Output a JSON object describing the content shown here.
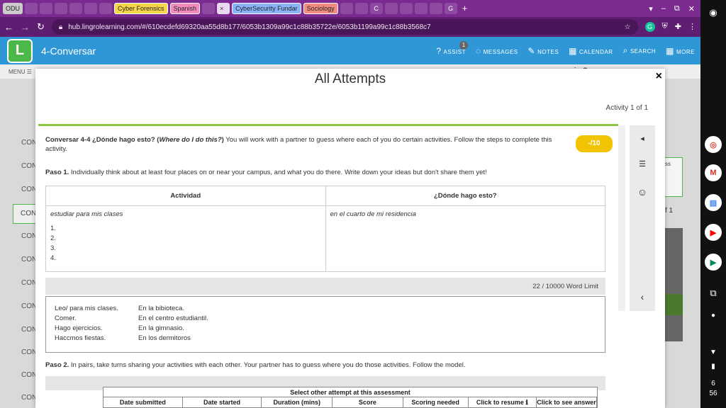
{
  "browser": {
    "tabs": [
      {
        "label": "ODU",
        "kind": "text"
      },
      {
        "label": "",
        "kind": "icon"
      },
      {
        "label": "",
        "kind": "icon"
      },
      {
        "label": "",
        "kind": "icon"
      },
      {
        "label": "",
        "kind": "icon"
      },
      {
        "label": "",
        "kind": "icon"
      },
      {
        "label": "",
        "kind": "icon"
      },
      {
        "label": "Cyber Forensics",
        "kind": "group",
        "color": "#f7d64a"
      },
      {
        "label": "Spanish",
        "kind": "group",
        "color": "#f28cc0"
      },
      {
        "label": "",
        "kind": "icon"
      },
      {
        "label": "×",
        "kind": "active"
      },
      {
        "label": "CyberSecurity Fundar",
        "kind": "group",
        "color": "#8ab4f8"
      },
      {
        "label": "Sociology",
        "kind": "group",
        "color": "#f28b82"
      },
      {
        "label": "",
        "kind": "icon"
      },
      {
        "label": "",
        "kind": "icon"
      },
      {
        "label": "C",
        "kind": "icon"
      },
      {
        "label": "",
        "kind": "icon"
      },
      {
        "label": "",
        "kind": "icon"
      },
      {
        "label": "",
        "kind": "icon"
      },
      {
        "label": "",
        "kind": "icon"
      },
      {
        "label": "G",
        "kind": "icon"
      }
    ],
    "new_tab": "+",
    "url": "hub.lingrolearning.com/#/610ecdefd69320aa55d8b177/6053b1309a99c1c88b35722e/6053b1199a99c1c88b3568c7"
  },
  "app": {
    "title": "4-Conversar",
    "logo_letter": "L",
    "nav": [
      {
        "icon": "?",
        "label": "ASSIST"
      },
      {
        "icon": "◌",
        "label": "MESSAGES"
      },
      {
        "icon": "✎",
        "label": "NOTES"
      },
      {
        "icon": "▦",
        "label": "CALENDAR"
      },
      {
        "icon": "⌕",
        "label": "SEARCH"
      },
      {
        "icon": "▦",
        "label": "MORE"
      }
    ],
    "messages_count": "1"
  },
  "background": {
    "menu": "MENU ☰",
    "rows": [
      "CON",
      "CON",
      "CON",
      "CON",
      "CON",
      "CON",
      "CON",
      "CON",
      "CON",
      "CON",
      "CON",
      "CON"
    ],
    "active_row": "CON",
    "top_right_text": "iro?",
    "right_box_text": "ss",
    "right_count": "f 1"
  },
  "modal": {
    "title": "All Attempts",
    "close": "×",
    "activity_count": "Activity 1 of 1",
    "intro_bold": "Conversar 4-4 ¿Dónde hago esto? (",
    "intro_italic": "Where do I do this?",
    "intro_bold_end": ")",
    "intro_rest": " You will work with a partner to guess where each of you do certain activities. Follow the steps to complete this activity.",
    "score": "-/10",
    "paso1_label": "Paso 1.",
    "paso1_text": " Individually think about at least four places on or near your campus, and what you do there. Write down your ideas but don't share them yet!",
    "table": {
      "headers": [
        "Actividad",
        "¿Dónde hago esto?"
      ],
      "col1_example": "estudiar para mis clases",
      "col2_example": "en el cuarto de mi residencia",
      "numbers": [
        "1.",
        "2.",
        "3.",
        "4."
      ]
    },
    "word_limit": "22 /  10000 Word Limit",
    "answer_lines": [
      [
        "Leo/ para mis clases.",
        "En la bibioteca."
      ],
      [
        "Comer.",
        "En el centro estudiantil."
      ],
      [
        "Hago ejercicios.",
        "En la gimnasio."
      ],
      [
        "Haccmos fiestas.",
        "En los dermitoros"
      ]
    ],
    "paso2_label": "Paso 2.",
    "paso2_text": " In pairs, take turns sharing your activities with each other. Your partner has to guess where you do those activities. Follow the model.",
    "side_icons": [
      "◂",
      "☰",
      "☺",
      "‹"
    ]
  },
  "attempts": {
    "caption": "Select other attempt at this assessment",
    "columns": [
      "Date submitted",
      "Date started",
      "Duration (mins)",
      "Score",
      "Scoring needed",
      "Click to  resume ℹ",
      "Click to see answers"
    ]
  },
  "shelf": {
    "time_hour": "6",
    "time_min": "56",
    "apps": [
      "chrome-app",
      "gmail-app",
      "docs-app",
      "youtube-app",
      "play-store-app"
    ]
  }
}
